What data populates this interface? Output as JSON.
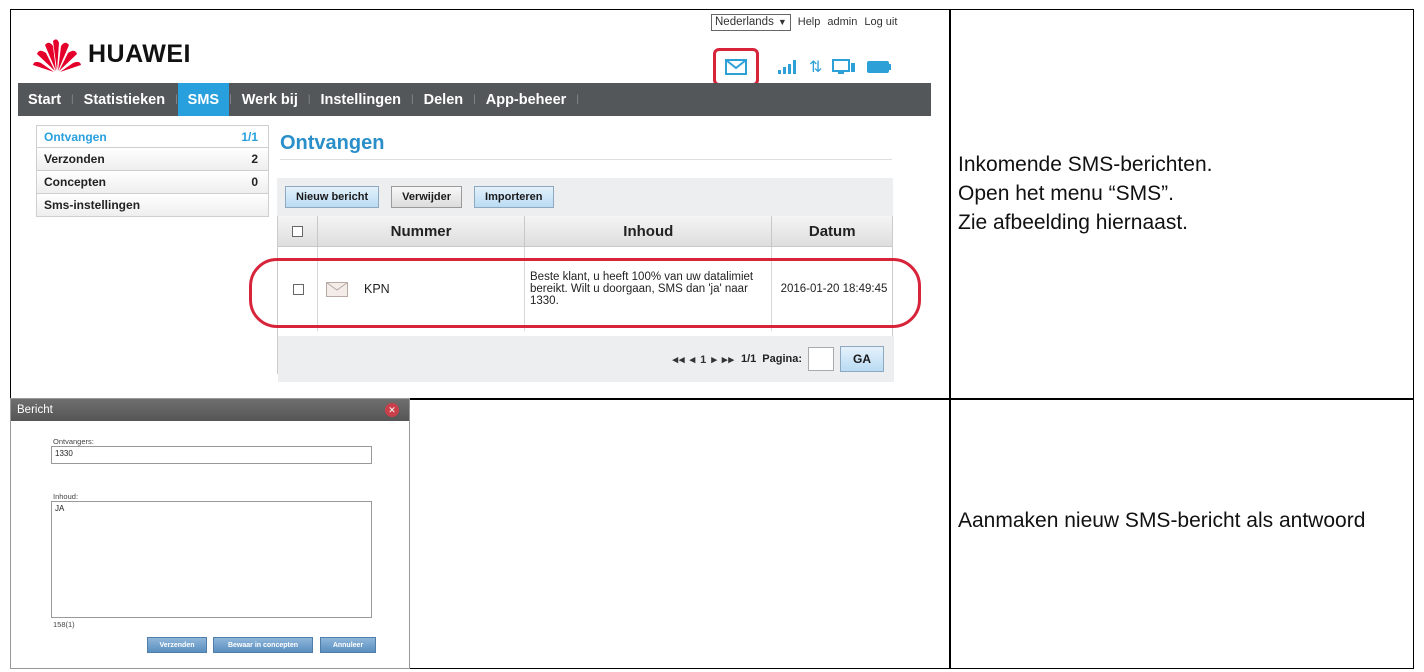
{
  "top_screenshot": {
    "header": {
      "language": "Nederlands",
      "links": [
        "Help",
        "admin",
        "Log uit"
      ],
      "brand": "HUAWEI"
    },
    "nav": {
      "items": [
        "Start",
        "Statistieken",
        "SMS",
        "Werk bij",
        "Instellingen",
        "Delen",
        "App-beheer"
      ],
      "active": "SMS"
    },
    "sidebar": {
      "items": [
        {
          "label": "Ontvangen",
          "count": "1/1"
        },
        {
          "label": "Verzonden",
          "count": "2"
        },
        {
          "label": "Concepten",
          "count": "0"
        },
        {
          "label": "Sms-instellingen",
          "count": ""
        }
      ]
    },
    "main": {
      "title": "Ontvangen",
      "buttons": [
        "Nieuw bericht",
        "Verwijder",
        "Importeren"
      ],
      "columns": [
        "Nummer",
        "Inhoud",
        "Datum"
      ],
      "rows": [
        {
          "number": "KPN",
          "content": "Beste klant, u heeft 100% van uw datalimiet bereikt. Wilt u doorgaan, SMS dan 'ja' naar 1330.",
          "date": "2016-01-20 18:49:45"
        }
      ],
      "pager": {
        "controls": "◂◂ ◂ 1 ▸ ▸▸",
        "pages": "1/1",
        "page_label": "Pagina:",
        "go_label": "GA"
      }
    },
    "accent_color": "#27a0dd",
    "highlight_color": "#d7243b"
  },
  "description_1": [
    "Inkomende SMS-berichten.",
    "Open het menu “SMS”.",
    "Zie afbeelding hiernaast."
  ],
  "bottom_screenshot": {
    "dialog_title": "Bericht",
    "recipients_label": "Ontvangers:",
    "recipients_value": "1330",
    "content_label": "Inhoud:",
    "content_value": "JA",
    "char_count": "158(1)",
    "buttons": [
      "Verzenden",
      "Bewaar in concepten",
      "Annuleer"
    ]
  },
  "description_2": "Aanmaken nieuw SMS-bericht als antwoord"
}
